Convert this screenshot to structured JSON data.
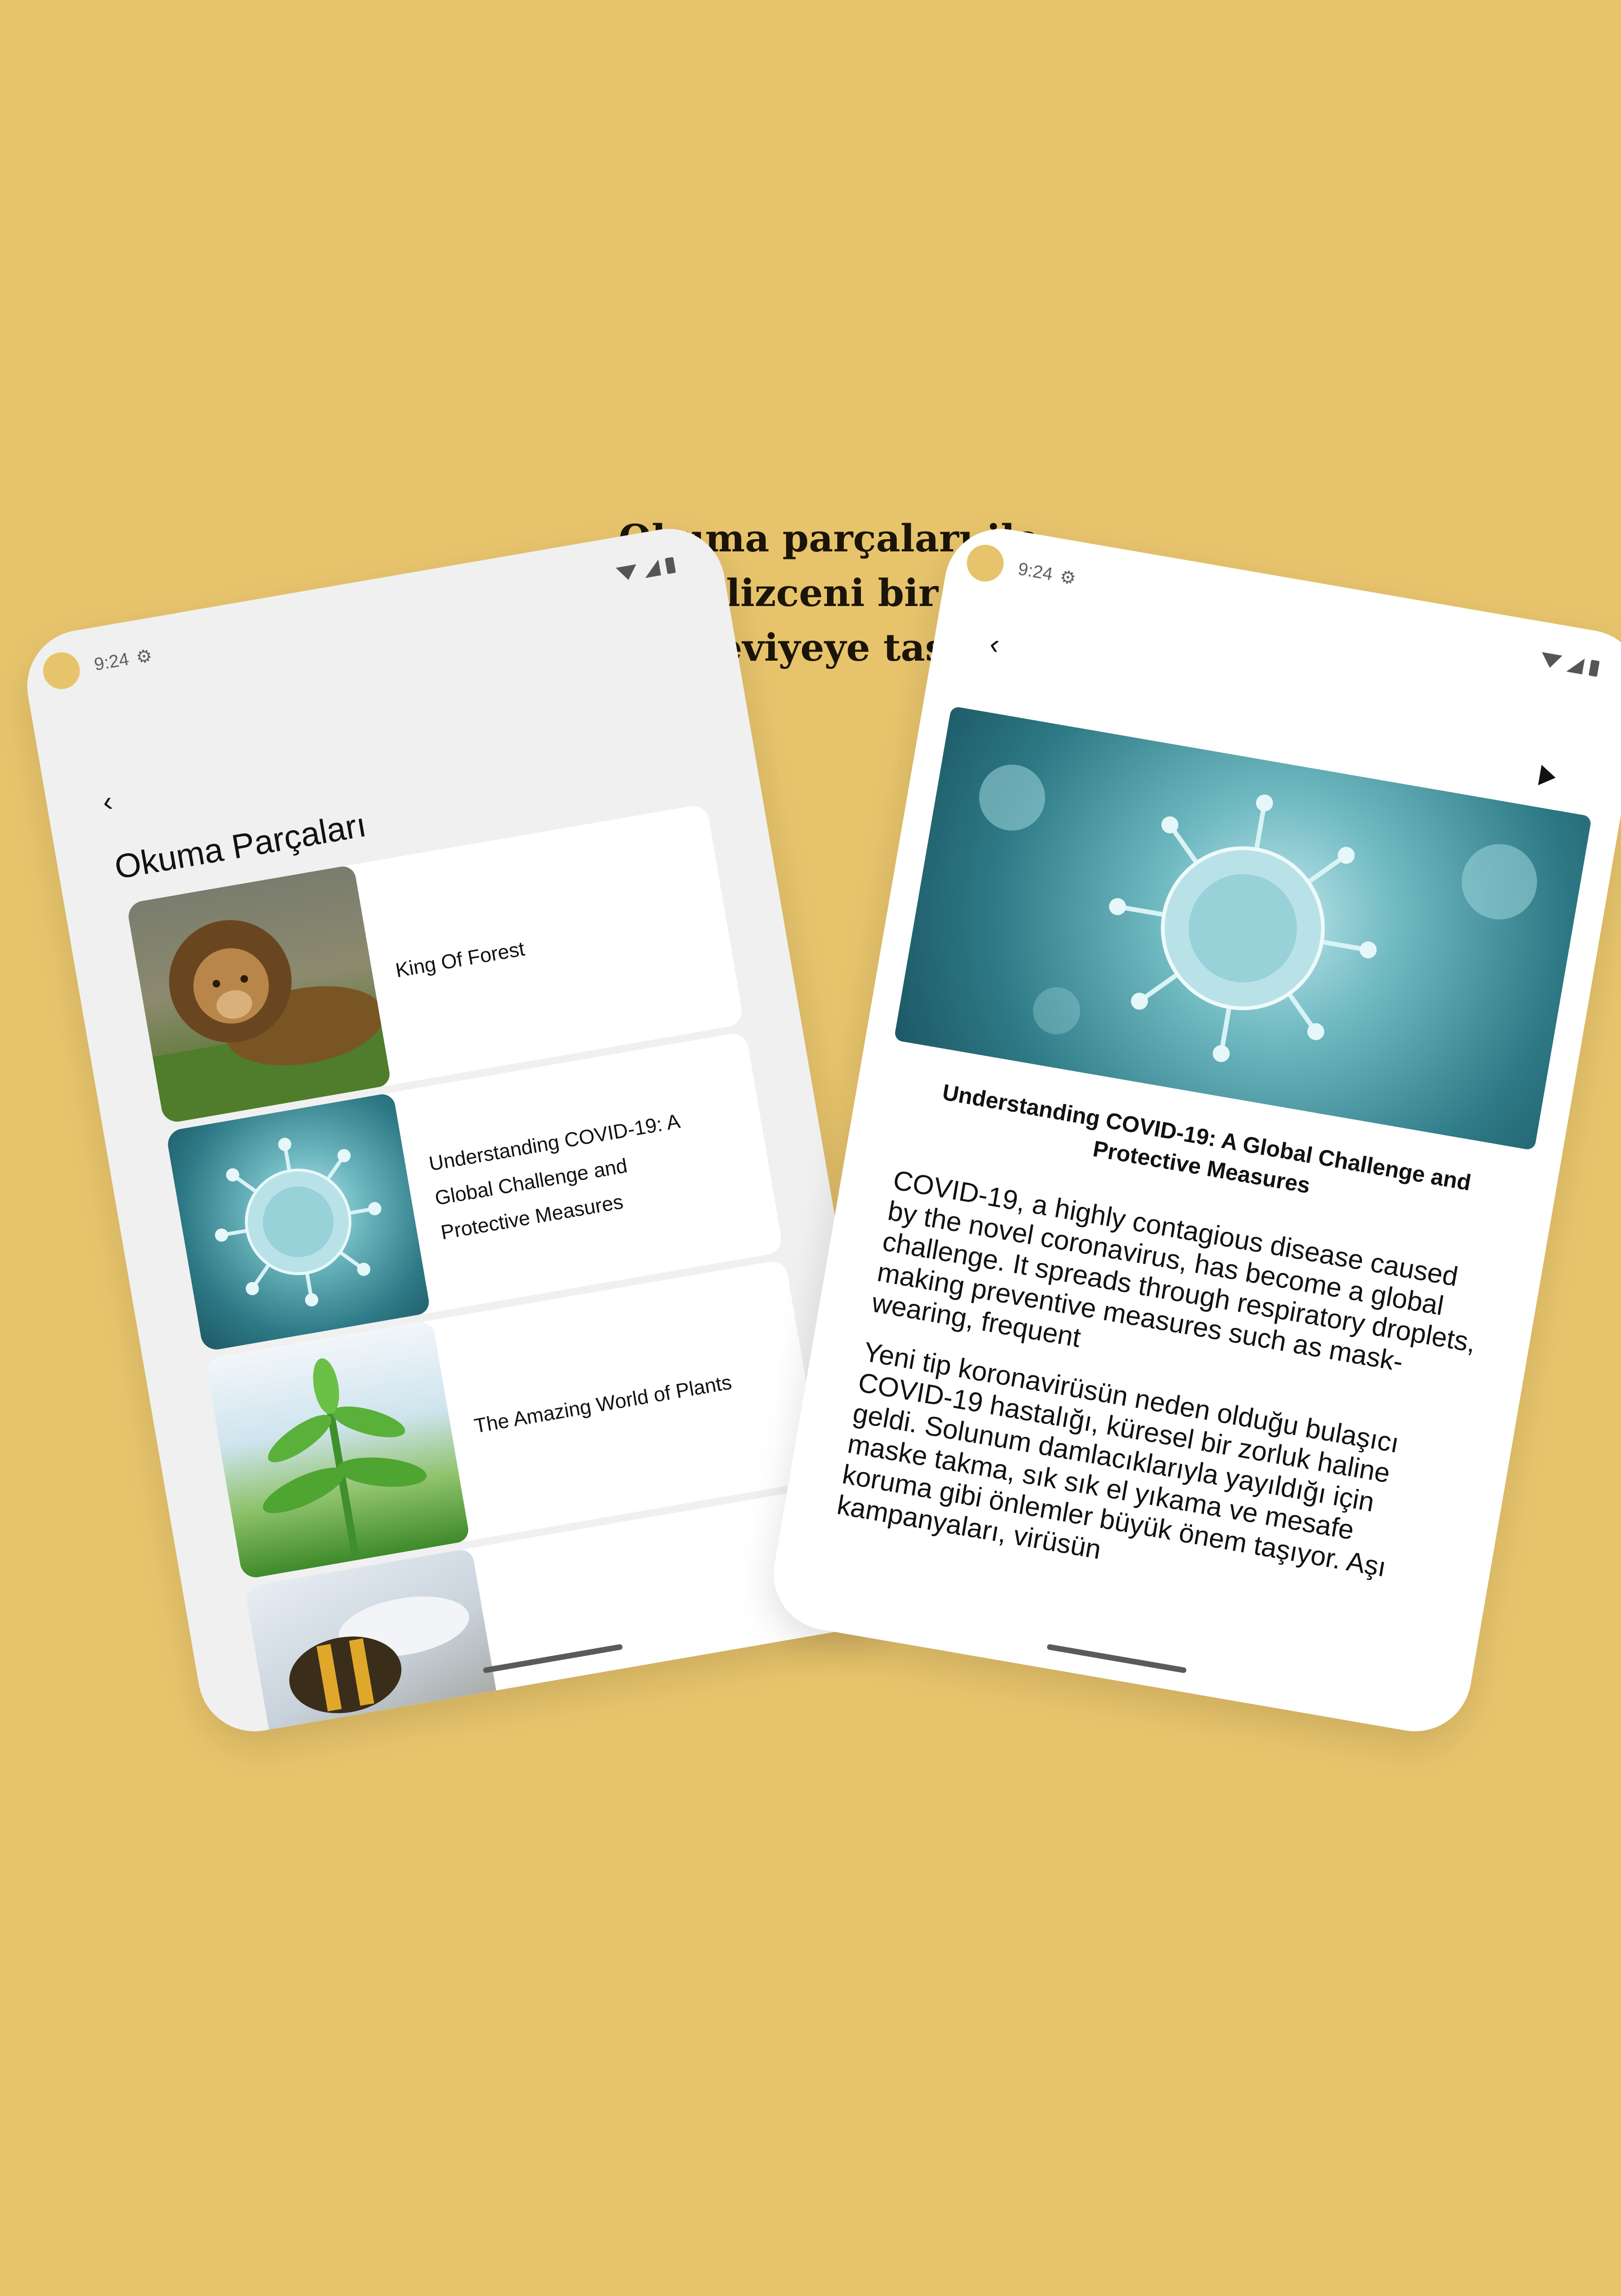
{
  "headline": {
    "line1": "Okuma parçaları ile",
    "line2": "İngilizceni bir üst",
    "line3": "seviyeye taşı"
  },
  "left_phone": {
    "status": {
      "time": "9:24"
    },
    "back_label": "‹",
    "title": "Okuma Parçaları",
    "items": [
      {
        "label": "King Of Forest",
        "image": "lion"
      },
      {
        "label": "Understanding COVID-19: A Global Challenge and Protective Measures",
        "image": "virus"
      },
      {
        "label": "The Amazing World of Plants",
        "image": "plant"
      },
      {
        "label": "",
        "image": "bee"
      }
    ]
  },
  "right_phone": {
    "status": {
      "time": "9:24"
    },
    "back_label": "‹",
    "article_title": "Understanding COVID-19: A Global Challenge and Protective Measures",
    "english_text": "COVID-19, a highly contagious disease caused by the novel coronavirus, has become a global challenge. It spreads through respiratory droplets, making preventive measures such as mask-wearing, frequent",
    "turkish_text": "Yeni tip koronavirüsün neden olduğu bulaşıcı COVID-19 hastalığı, küresel bir zorluk haline geldi. Solunum damlacıklarıyla yayıldığı için maske takma, sık sık el yıkama ve mesafe koruma gibi önlemler büyük önem taşıyor. Aşı kampanyaları, virüsün"
  }
}
